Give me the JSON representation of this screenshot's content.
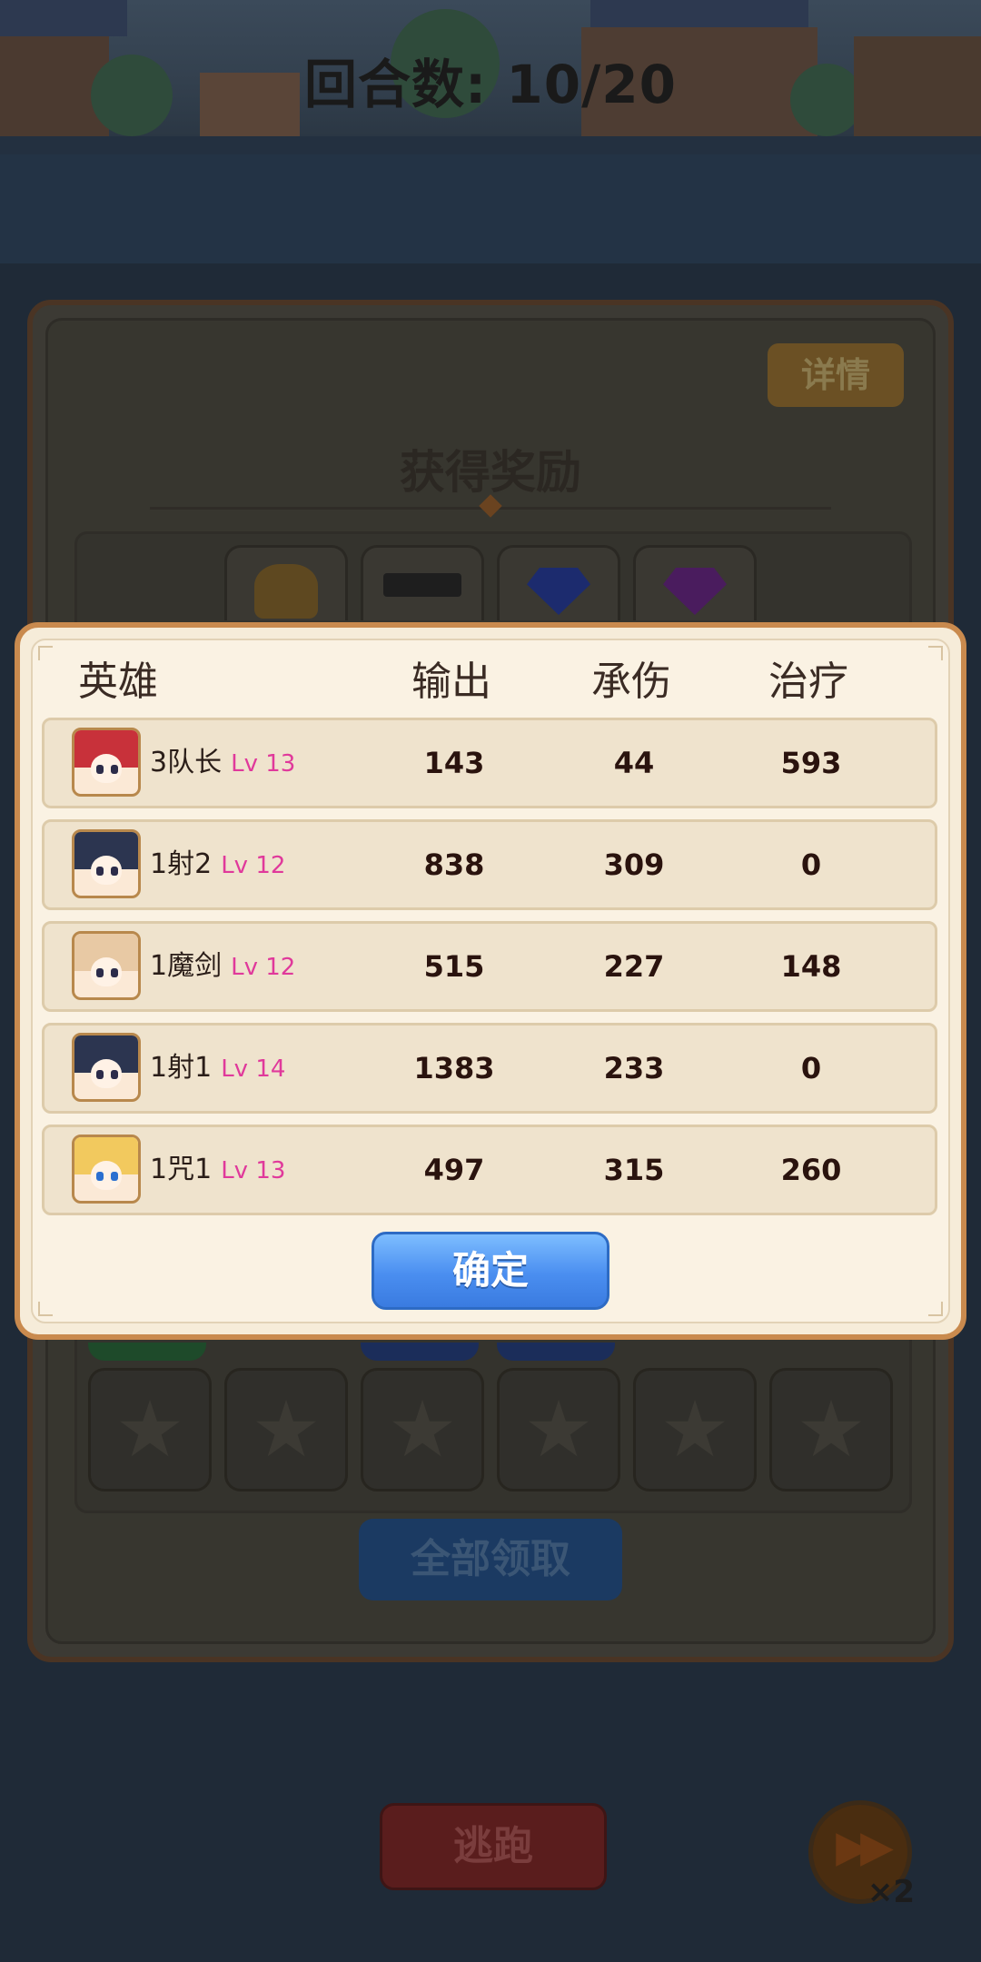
{
  "battle": {
    "round_counter": "回合数: 10/20"
  },
  "reward_panel": {
    "details_label": "详情",
    "title": "获得奖励",
    "claim_all_label": "全部领取"
  },
  "controls": {
    "escape_label": "逃跑",
    "speed_multiplier": "×2"
  },
  "stats_dialog": {
    "headers": {
      "hero": "英雄",
      "damage": "输出",
      "taken": "承伤",
      "heal": "治疗"
    },
    "rows": [
      {
        "name": "3队长",
        "level": "Lv 13",
        "damage": "143",
        "taken": "44",
        "heal": "593",
        "avatar_hair": "#c8313a"
      },
      {
        "name": "1射2",
        "level": "Lv 12",
        "damage": "838",
        "taken": "309",
        "heal": "0",
        "avatar_hair": "#2c3550"
      },
      {
        "name": "1魔剑",
        "level": "Lv 12",
        "damage": "515",
        "taken": "227",
        "heal": "148",
        "avatar_hair": "#e8c9a4"
      },
      {
        "name": "1射1",
        "level": "Lv 14",
        "damage": "1383",
        "taken": "233",
        "heal": "0",
        "avatar_hair": "#2c3550"
      },
      {
        "name": "1咒1",
        "level": "Lv 13",
        "damage": "497",
        "taken": "315",
        "heal": "260",
        "avatar_hair": "#f2c95e"
      }
    ],
    "confirm_label": "确定"
  },
  "colors": {
    "dialog_border": "#c98a4e",
    "level_text": "#e0399b",
    "confirm_button": "#4a8ef0"
  }
}
